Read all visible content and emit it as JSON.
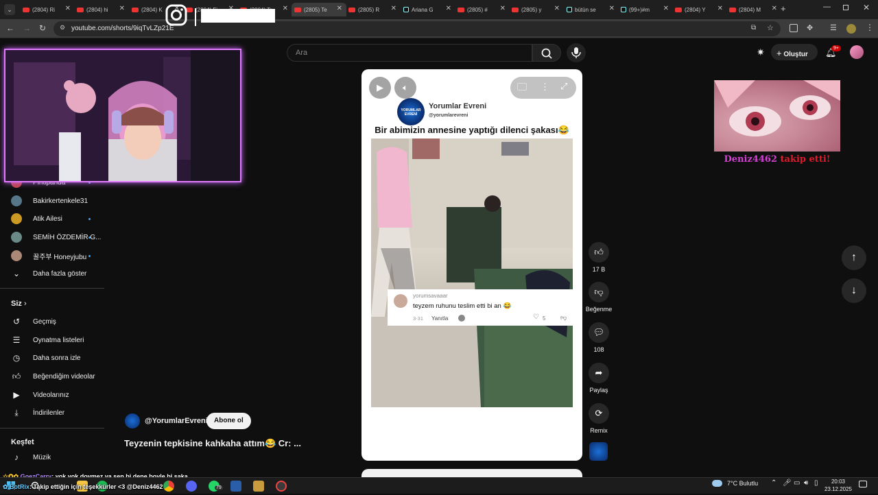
{
  "browser": {
    "tabs": [
      {
        "label": "(2804) Ri",
        "icon": "youtube"
      },
      {
        "label": "(2804) hi",
        "icon": "youtube"
      },
      {
        "label": "(2804) K",
        "icon": "youtube"
      },
      {
        "label": "(2804) Fi",
        "icon": "youtube"
      },
      {
        "label": "(2804) Tr",
        "icon": "youtube"
      },
      {
        "label": "(2805) Te",
        "icon": "youtube"
      },
      {
        "label": "(2805) R",
        "icon": "youtube"
      },
      {
        "label": "Ariana G",
        "icon": "tiktok"
      },
      {
        "label": "(2805) #",
        "icon": "youtube"
      },
      {
        "label": "(2805) y",
        "icon": "youtube"
      },
      {
        "label": "bütün se",
        "icon": "tiktok"
      },
      {
        "label": "(99+)#m",
        "icon": "tiktok"
      },
      {
        "label": "(2804) Y",
        "icon": "youtube"
      },
      {
        "label": "(2804) M",
        "icon": "youtube"
      }
    ],
    "active_tab_index": 5,
    "url": "youtube.com/shorts/9iqTvLZp21E"
  },
  "youtube": {
    "search_placeholder": "Ara",
    "create_label": "Oluştur",
    "notif_badge": "9+"
  },
  "sidebar": {
    "subscriptions": [
      {
        "name": "Pintipanda",
        "dot": true
      },
      {
        "name": "Bakirkertenkele31",
        "dot": false
      },
      {
        "name": "Atik Ailesi",
        "dot": true
      },
      {
        "name": "SEMİH ÖZDEMİR G...",
        "dot": true
      },
      {
        "name": "꿀주부 Honeyjubu",
        "dot": true
      }
    ],
    "show_more": "Daha fazla göster",
    "you_header": "Siz",
    "you_items": [
      "Geçmiş",
      "Oynatma listeleri",
      "Daha sonra izle",
      "Beğendiğim videolar",
      "Videolarınız",
      "İndirilenler"
    ],
    "explore_header": "Keşfet",
    "explore_items": [
      "Müzik"
    ]
  },
  "short": {
    "channel_name_overlay": "Yorumlar Evreni",
    "channel_handle_overlay": "@yorumlarevreni",
    "logo_text": "YORUMLAR EVRENİ",
    "caption": "Bir abimizin annesine yaptığı dilenci şakası😂",
    "comment": {
      "user": "yorumsavaaar",
      "text": "teyzem ruhunu teslim etti bi an 😂",
      "date": "3-31",
      "reply_label": "Yanıtla",
      "likes": "5"
    },
    "channel_handle": "@YorumlarEvrenii",
    "subscribe_label": "Abone ol",
    "title": "Teyzenin tepkisine kahkaha attım😂  Cr: ..."
  },
  "actions": {
    "like_count": "17 B",
    "dislike_label": "Beğenme",
    "comment_count": "108",
    "share_label": "Paylaş",
    "remix_label": "Remix"
  },
  "alert": {
    "username": "Deniz4462",
    "message": "takip etti!",
    "username_color": "#d63fd6",
    "message_color": "#e01c2c"
  },
  "chat": [
    {
      "user": "GoezCarry",
      "text": ": yok yok dovmez ya sen bi dene boyle bi saka"
    },
    {
      "user": "BotRix",
      "text": ": Takip ettiğin için teşekkürler <3 @Deniz4462"
    }
  ],
  "taskbar": {
    "badge_count": "79",
    "weather": "7°C  Bulutlu",
    "time": "20:03",
    "date": "23.12.2025"
  }
}
